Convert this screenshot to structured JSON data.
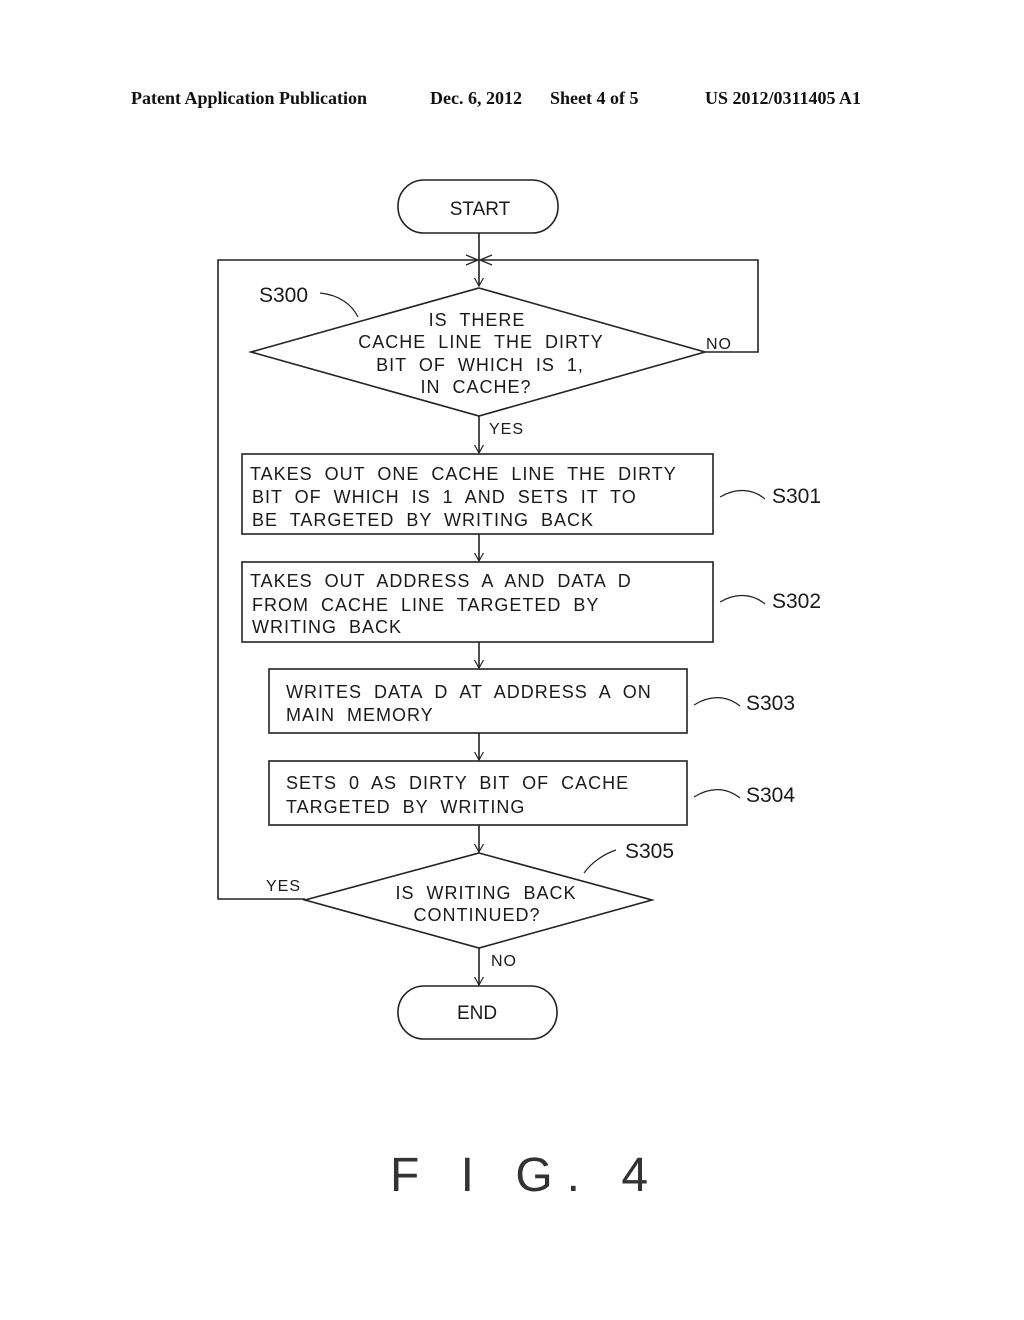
{
  "header": {
    "publication": "Patent Application Publication",
    "date": "Dec. 6, 2012",
    "sheet": "Sheet 4 of 5",
    "number": "US 2012/0311405 A1"
  },
  "flowchart": {
    "start": "START",
    "end": "END",
    "steps": [
      {
        "id": "S300",
        "type": "decision",
        "lines": [
          "IS THERE",
          "CACHE LINE THE DIRTY",
          "BIT OF WHICH IS 1,",
          "IN CACHE?"
        ],
        "yes": "YES",
        "no": "NO"
      },
      {
        "id": "S301",
        "type": "process",
        "lines": [
          "TAKES OUT ONE CACHE LINE THE DIRTY",
          "BIT OF WHICH IS 1 AND SETS IT TO",
          "BE TARGETED BY WRITING BACK"
        ]
      },
      {
        "id": "S302",
        "type": "process",
        "lines": [
          "TAKES OUT ADDRESS A AND DATA D",
          "FROM CACHE LINE TARGETED BY",
          "WRITING BACK"
        ]
      },
      {
        "id": "S303",
        "type": "process",
        "lines": [
          "WRITES DATA D AT ADDRESS A ON",
          "MAIN MEMORY"
        ]
      },
      {
        "id": "S304",
        "type": "process",
        "lines": [
          "SETS 0 AS DIRTY BIT OF CACHE",
          "TARGETED BY WRITING"
        ]
      },
      {
        "id": "S305",
        "type": "decision",
        "lines": [
          "IS WRITING BACK",
          "CONTINUED?"
        ],
        "yes": "YES",
        "no": "NO"
      }
    ]
  },
  "figure_label": "F I G. 4"
}
